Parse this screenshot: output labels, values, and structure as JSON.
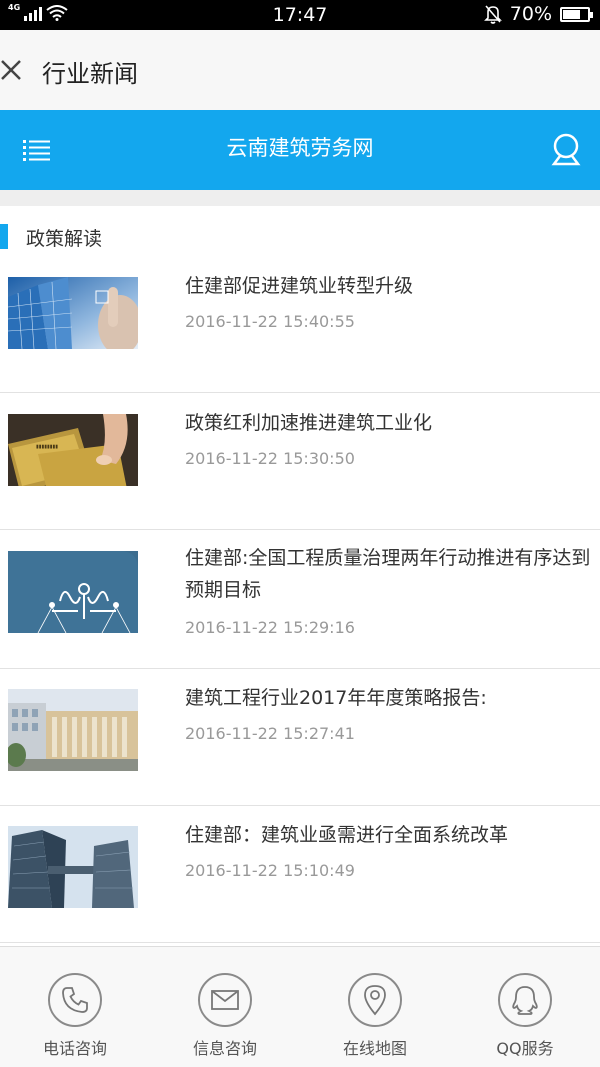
{
  "status_bar": {
    "network": "4G",
    "time": "17:47",
    "battery_text": "70%",
    "battery_level": 0.7
  },
  "title_bar": {
    "title": "行业新闻",
    "close_icon": "close-icon"
  },
  "header": {
    "title": "云南建筑劳务网",
    "menu_icon": "menu-list-icon",
    "user_icon": "user-icon",
    "color": "#13a7ee"
  },
  "section": {
    "title": "政策解读"
  },
  "news": [
    {
      "title": "住建部促进建筑业转型升级",
      "date": "2016-11-22 15:40:55",
      "thumb": "glass-building-touch-image"
    },
    {
      "title": "政策红利加速推进建筑工业化",
      "date": "2016-11-22 15:30:50",
      "thumb": "gold-cards-image"
    },
    {
      "title": "住建部:全国工程质量治理两年行动推进有序达到预期目标",
      "date": "2016-11-22 15:29:16",
      "thumb": "scales-image"
    },
    {
      "title": "建筑工程行业2017年年度策略报告:",
      "date": "2016-11-22 15:27:41",
      "thumb": "office-building-image"
    },
    {
      "title": "住建部：建筑业亟需进行全面系统改革",
      "date": "2016-11-22 15:10:49",
      "thumb": "skyscrapers-image"
    }
  ],
  "bottom_nav": [
    {
      "label": "电话咨询",
      "icon": "phone-icon"
    },
    {
      "label": "信息咨询",
      "icon": "mail-icon"
    },
    {
      "label": "在线地图",
      "icon": "map-pin-icon"
    },
    {
      "label": "QQ服务",
      "icon": "qq-icon"
    }
  ]
}
